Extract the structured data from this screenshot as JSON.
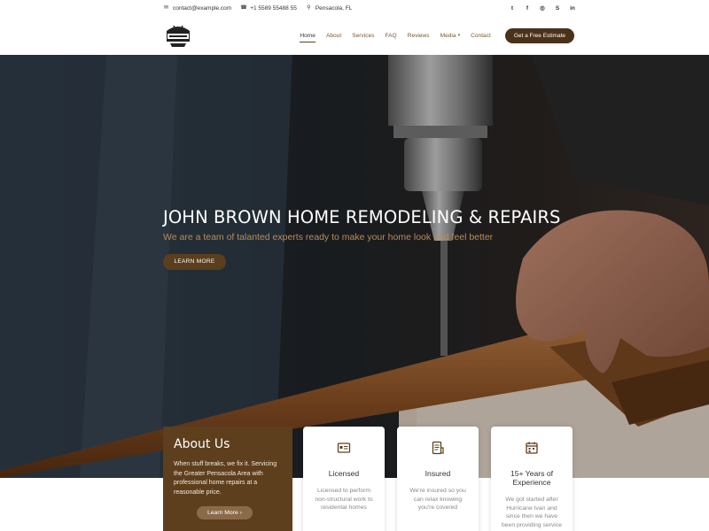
{
  "topbar": {
    "email": "contact@example.com",
    "phone": "+1 5589 55488 55",
    "location": "Pensacola, FL",
    "socials": [
      {
        "name": "twitter-icon",
        "glyph": "t"
      },
      {
        "name": "facebook-icon",
        "glyph": "f"
      },
      {
        "name": "instagram-icon",
        "glyph": "◎"
      },
      {
        "name": "skype-icon",
        "glyph": "S"
      },
      {
        "name": "linkedin-icon",
        "glyph": "in"
      }
    ]
  },
  "nav": {
    "items": [
      "Home",
      "About",
      "Services",
      "FAQ",
      "Reviews",
      "Media",
      "Contact"
    ],
    "cta": "Get a Free Estimate"
  },
  "hero": {
    "title": "JOHN BROWN HOME REMODELING & REPAIRS",
    "subtitle": "We are a team of talanted experts ready to make your home look and feel better",
    "button": "LEARN MORE"
  },
  "about": {
    "title": "About Us",
    "text": "When stuff breaks, we fix it. Servicing the Greater Pensacola Area with professional home repairs at a reasonable price.",
    "button": "Learn More ›"
  },
  "cards": [
    {
      "title": "Licensed",
      "text": "Licensed to perform non-structural work to residental homes"
    },
    {
      "title": "Insured",
      "text": "We're insured so you can relax knowing you're covered"
    },
    {
      "title": "15+ Years of Experience",
      "text": "We got started after Hurricane Ivan and since then we have been providing service"
    }
  ],
  "colors": {
    "brand": "#5e3f1d",
    "accent": "#b78d5a"
  }
}
